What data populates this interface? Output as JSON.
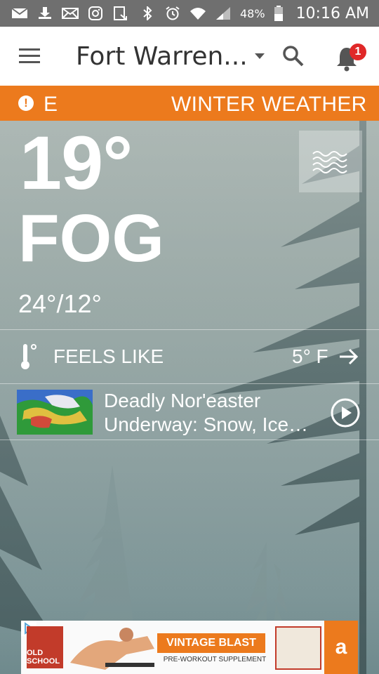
{
  "status_bar": {
    "battery_percent": "48%",
    "time": "10:16 AM",
    "icons": [
      "mail-icon",
      "download-icon",
      "email-icon",
      "instagram-icon",
      "nfc-icon",
      "bluetooth-icon",
      "alarm-icon",
      "wifi-icon",
      "signal-icon",
      "battery-icon"
    ]
  },
  "app_bar": {
    "location": "Fort Warren...",
    "notification_count": "1"
  },
  "alert": {
    "icon": "!",
    "fragment": "E",
    "text": "WINTER WEATHER"
  },
  "current": {
    "temperature": "19°",
    "condition": "FOG",
    "hi_lo": "24°/12°"
  },
  "feels_like": {
    "label": "FEELS LIKE",
    "value": "5° F"
  },
  "news": {
    "title": "Deadly Nor'easter Underway: Snow, Ice…"
  },
  "ad": {
    "cta": "VINTAGE BLAST",
    "subtitle": "PRE-WORKOUT SUPPLEMENT",
    "logo_text": "OLD SCHOOL",
    "amazon_glyph": "a"
  },
  "colors": {
    "accent_orange": "#ec7a1d",
    "status_bar": "#6f6f6f",
    "badge_red": "#e02828"
  }
}
